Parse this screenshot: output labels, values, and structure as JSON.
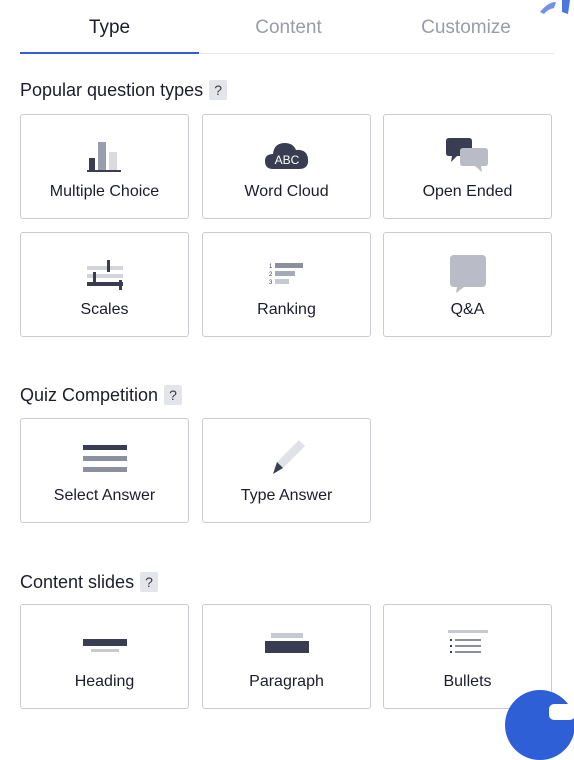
{
  "tabs": [
    {
      "label": "Type",
      "active": true
    },
    {
      "label": "Content",
      "active": false
    },
    {
      "label": "Customize",
      "active": false
    }
  ],
  "sections": {
    "popular": {
      "title": "Popular question types",
      "help": "?",
      "items": [
        {
          "label": "Multiple Choice",
          "icon": "bar-chart-icon"
        },
        {
          "label": "Word Cloud",
          "icon": "word-cloud-icon"
        },
        {
          "label": "Open Ended",
          "icon": "speech-bubbles-icon"
        },
        {
          "label": "Scales",
          "icon": "sliders-icon"
        },
        {
          "label": "Ranking",
          "icon": "ranking-icon"
        },
        {
          "label": "Q&A",
          "icon": "qa-bubble-icon"
        }
      ]
    },
    "quiz": {
      "title": "Quiz Competition",
      "help": "?",
      "items": [
        {
          "label": "Select Answer",
          "icon": "list-lines-icon"
        },
        {
          "label": "Type Answer",
          "icon": "pencil-icon"
        }
      ]
    },
    "content": {
      "title": "Content slides",
      "help": "?",
      "items": [
        {
          "label": "Heading",
          "icon": "heading-icon"
        },
        {
          "label": "Paragraph",
          "icon": "paragraph-icon"
        },
        {
          "label": "Bullets",
          "icon": "bullets-icon"
        }
      ]
    }
  },
  "word_cloud_icon_text": "ABC",
  "ranking_icon_numbers": [
    "1",
    "2",
    "3"
  ],
  "colors": {
    "accent": "#2f5fd6",
    "icon_dark": "#3a3d52",
    "icon_light": "#c7c9d0",
    "border": "#c9cbd3"
  }
}
